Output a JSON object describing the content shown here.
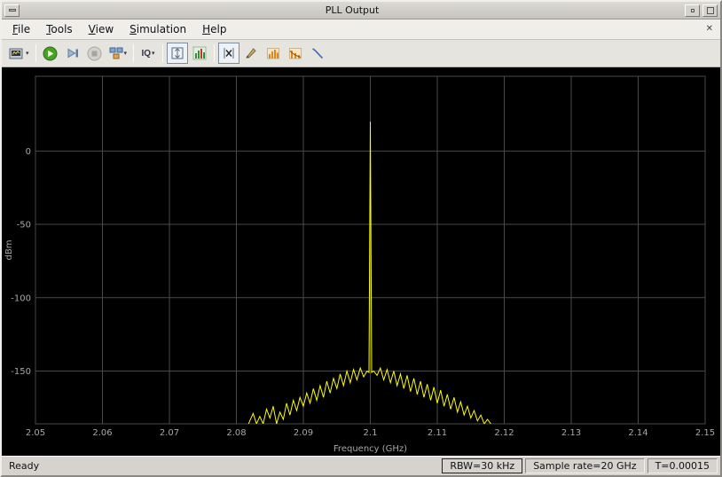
{
  "window": {
    "title": "PLL Output"
  },
  "menu": {
    "items": [
      {
        "label": "File"
      },
      {
        "label": "Tools"
      },
      {
        "label": "View"
      },
      {
        "label": "Simulation"
      },
      {
        "label": "Help"
      }
    ]
  },
  "toolbar": {
    "iq_label": "IQ",
    "buttons": [
      "scope-settings",
      "run",
      "step-forward",
      "stop",
      "simulation-source",
      "input-iq",
      "autoscale",
      "spectrum-settings",
      "cursor-measurements",
      "peak-finder",
      "channel-measurements",
      "distortion-measurements",
      "ccdf-measurements"
    ]
  },
  "status": {
    "ready": "Ready",
    "rbw": "RBW=30 kHz",
    "sample_rate": "Sample rate=20 GHz",
    "time": "T=0.00015"
  },
  "chart_data": {
    "type": "line",
    "title": "",
    "xlabel": "Frequency (GHz)",
    "ylabel": "dBm",
    "xlim": [
      2.05,
      2.15
    ],
    "ylim": [
      -186,
      51
    ],
    "x_ticks": [
      2.05,
      2.06,
      2.07,
      2.08,
      2.09,
      2.1,
      2.11,
      2.12,
      2.13,
      2.14,
      2.15
    ],
    "x_tick_labels": [
      "2.05",
      "2.06",
      "2.07",
      "2.08",
      "2.09",
      "2.1",
      "2.11",
      "2.12",
      "2.13",
      "2.14",
      "2.15"
    ],
    "y_ticks": [
      0,
      -50,
      -100,
      -150
    ],
    "grid": true,
    "legend": "none",
    "line_color": "#ffff00",
    "plot_bg": "#000000",
    "grid_color": "#4a4a4a",
    "tick_color": "#a8a8a8",
    "peak": {
      "freq_ghz": 2.1,
      "amplitude_dbm": 20
    },
    "series": [
      {
        "name": "spectrum-trace",
        "points": [
          [
            2.05,
            -190
          ],
          [
            2.0815,
            -190
          ],
          [
            2.082,
            -184
          ],
          [
            2.0825,
            -179
          ],
          [
            2.083,
            -186
          ],
          [
            2.0835,
            -181
          ],
          [
            2.084,
            -186
          ],
          [
            2.0845,
            -176
          ],
          [
            2.085,
            -182
          ],
          [
            2.0855,
            -174
          ],
          [
            2.086,
            -186
          ],
          [
            2.0865,
            -178
          ],
          [
            2.087,
            -183
          ],
          [
            2.0875,
            -172
          ],
          [
            2.088,
            -180
          ],
          [
            2.0885,
            -170
          ],
          [
            2.089,
            -177
          ],
          [
            2.0895,
            -168
          ],
          [
            2.09,
            -174
          ],
          [
            2.0905,
            -165
          ],
          [
            2.091,
            -172
          ],
          [
            2.0915,
            -162
          ],
          [
            2.092,
            -170
          ],
          [
            2.0925,
            -160
          ],
          [
            2.093,
            -168
          ],
          [
            2.0935,
            -157
          ],
          [
            2.094,
            -165
          ],
          [
            2.0945,
            -155
          ],
          [
            2.095,
            -162
          ],
          [
            2.0955,
            -152
          ],
          [
            2.096,
            -160
          ],
          [
            2.0965,
            -150
          ],
          [
            2.097,
            -158
          ],
          [
            2.0975,
            -149
          ],
          [
            2.098,
            -156
          ],
          [
            2.0985,
            -148
          ],
          [
            2.099,
            -154
          ],
          [
            2.0995,
            -150
          ],
          [
            2.0998,
            -151
          ],
          [
            2.1,
            20
          ],
          [
            2.1002,
            -151
          ],
          [
            2.1005,
            -150
          ],
          [
            2.101,
            -153
          ],
          [
            2.1015,
            -148
          ],
          [
            2.102,
            -156
          ],
          [
            2.1025,
            -149
          ],
          [
            2.103,
            -158
          ],
          [
            2.1035,
            -150
          ],
          [
            2.104,
            -160
          ],
          [
            2.1045,
            -152
          ],
          [
            2.105,
            -162
          ],
          [
            2.1055,
            -153
          ],
          [
            2.106,
            -164
          ],
          [
            2.1065,
            -155
          ],
          [
            2.107,
            -166
          ],
          [
            2.1075,
            -157
          ],
          [
            2.108,
            -168
          ],
          [
            2.1085,
            -159
          ],
          [
            2.109,
            -170
          ],
          [
            2.1095,
            -161
          ],
          [
            2.11,
            -172
          ],
          [
            2.1105,
            -163
          ],
          [
            2.111,
            -174
          ],
          [
            2.1115,
            -166
          ],
          [
            2.112,
            -176
          ],
          [
            2.1125,
            -168
          ],
          [
            2.113,
            -178
          ],
          [
            2.1135,
            -171
          ],
          [
            2.114,
            -180
          ],
          [
            2.1145,
            -174
          ],
          [
            2.115,
            -182
          ],
          [
            2.1155,
            -177
          ],
          [
            2.116,
            -184
          ],
          [
            2.1165,
            -180
          ],
          [
            2.117,
            -186
          ],
          [
            2.1175,
            -183
          ],
          [
            2.118,
            -186
          ],
          [
            2.1185,
            -190
          ],
          [
            2.15,
            -190
          ]
        ]
      }
    ]
  }
}
